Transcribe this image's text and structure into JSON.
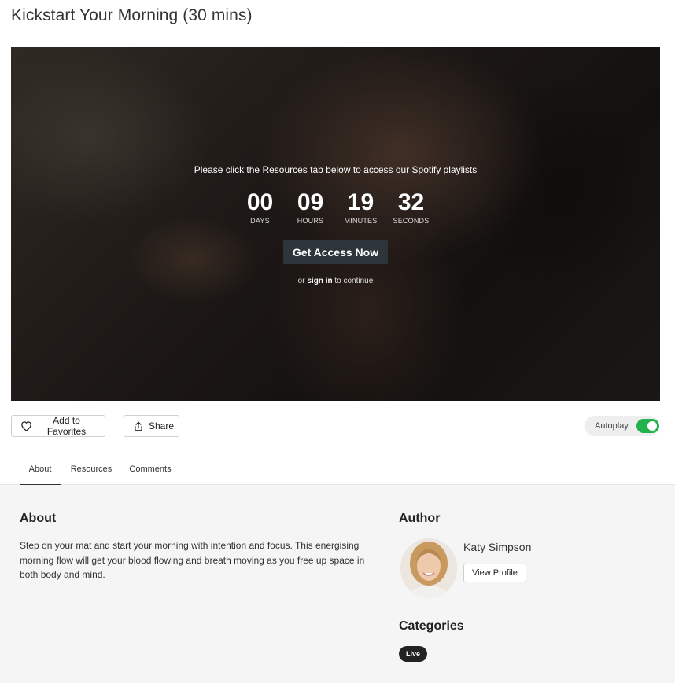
{
  "page": {
    "title": "Kickstart Your Morning (30 mins)"
  },
  "hero": {
    "message": "Please click the Resources tab below to access our Spotify playlists",
    "countdown": [
      {
        "value": "00",
        "label": "DAYS"
      },
      {
        "value": "09",
        "label": "HOURS"
      },
      {
        "value": "19",
        "label": "MINUTES"
      },
      {
        "value": "32",
        "label": "SECONDS"
      }
    ],
    "cta_label": "Get Access Now",
    "signin_prefix": "or",
    "signin_link": "sign in",
    "signin_suffix": "to continue"
  },
  "actions": {
    "favorites_label": "Add to Favorites",
    "share_label": "Share",
    "autoplay_label": "Autoplay",
    "autoplay_on": true
  },
  "tabs": [
    {
      "label": "About",
      "active": true
    },
    {
      "label": "Resources",
      "active": false
    },
    {
      "label": "Comments",
      "active": false
    }
  ],
  "about": {
    "heading": "About",
    "text": "Step on your mat and start your morning with intention and focus. This energising morning flow will get your blood flowing and breath moving as you free up space in both body and mind."
  },
  "author": {
    "heading": "Author",
    "name": "Katy Simpson",
    "view_profile_label": "View Profile"
  },
  "categories": {
    "heading": "Categories",
    "items": [
      "Live"
    ]
  },
  "colors": {
    "accent_toggle": "#22b14c",
    "cta_background": "#2d343a"
  }
}
